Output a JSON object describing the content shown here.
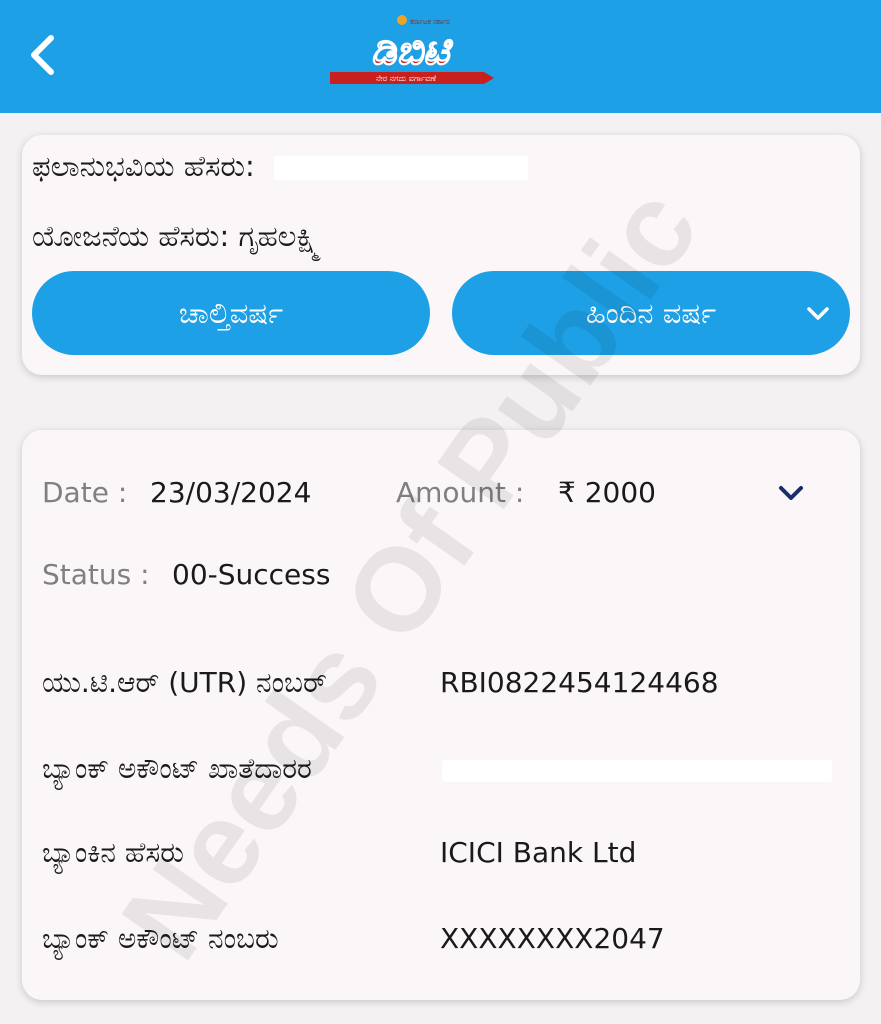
{
  "header": {
    "back_icon": "chevron-left-icon",
    "logo_text": "ಡಿಬಿಟಿ",
    "logo_top_caption": "ಕರ್ನಾಟಕ ಸರ್ಕಾರ",
    "logo_bottom_caption": "ನೇರ ನಗದು ವರ್ಗಾವಣೆ",
    "background_color": "#1ea0e6"
  },
  "beneficiary": {
    "name_label": "ಫಲಾನುಭವಿಯ ಹೆಸರು:",
    "scheme_label": "ಯೋಜನೆಯ ಹೆಸರು:",
    "scheme_value": "ಗೃಹಲಕ್ಷ್ಮಿ"
  },
  "year_tabs": {
    "current_label": "ಚಾಲ್ತಿವರ್ಷ",
    "previous_label": "ಹಿಂದಿನ ವರ್ಷ",
    "previous_icon": "chevron-down-icon"
  },
  "payment": {
    "date_label": "Date :",
    "date_value": "23/03/2024",
    "amount_label": "Amount :",
    "amount_value": "₹ 2000",
    "status_label": "Status :",
    "status_value": "00-Success",
    "expand_icon": "chevron-down-icon",
    "details": [
      {
        "label": "ಯು.ಟಿ.ಆರ್ (UTR) ನಂಬರ್",
        "value": "RBI0822454124468"
      },
      {
        "label": "ಬ್ಯಾಂಕ್ ಅಕೌಂಟ್ ಖಾತೆದಾರರ",
        "value": ""
      },
      {
        "label": "ಬ್ಯಾಂಕಿನ ಹೆಸರು",
        "value": "ICICI Bank Ltd"
      },
      {
        "label": "ಬ್ಯಾಂಕ್ ಅಕೌಂಟ್ ನಂಬರು",
        "value": "XXXXXXXX2047"
      }
    ]
  },
  "watermark": "Needs Of Public",
  "colors": {
    "accent": "#1ea0e6",
    "logo_red": "#c8201f",
    "label_gray": "#808080",
    "chevron_navy": "#1a2d6b"
  }
}
